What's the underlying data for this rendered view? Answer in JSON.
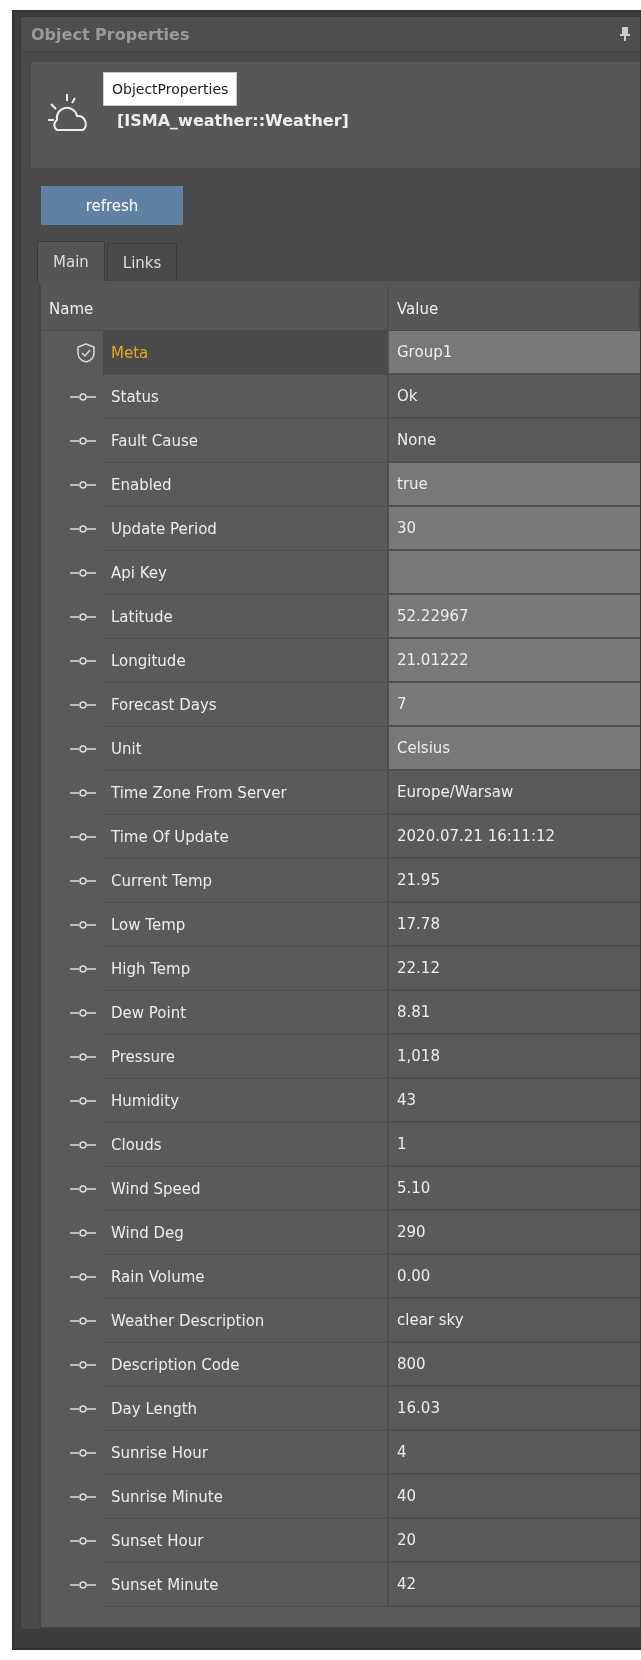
{
  "panel": {
    "title": "Object Properties"
  },
  "header": {
    "tooltip": "ObjectProperties",
    "object_type": "[ISMA_weather::Weather]"
  },
  "refresh_button": "refresh",
  "tabs": [
    {
      "label": "Main",
      "selected": true
    },
    {
      "label": "Links",
      "selected": false
    }
  ],
  "table": {
    "columns": [
      "Name",
      "Value"
    ],
    "rows": [
      {
        "kind": "meta",
        "name": "Meta",
        "value": "Group1",
        "editable": true
      },
      {
        "kind": "slot",
        "name": "Status",
        "value": "Ok",
        "editable": false
      },
      {
        "kind": "slot",
        "name": "Fault Cause",
        "value": "None",
        "editable": false
      },
      {
        "kind": "slot",
        "name": "Enabled",
        "value": "true",
        "editable": true
      },
      {
        "kind": "slot",
        "name": "Update Period",
        "value": "30",
        "editable": true
      },
      {
        "kind": "slot",
        "name": "Api Key",
        "editable": true
      },
      {
        "kind": "slot",
        "name": "Latitude",
        "value": "52.22967",
        "editable": true
      },
      {
        "kind": "slot",
        "name": "Longitude",
        "value": "21.01222",
        "editable": true
      },
      {
        "kind": "slot",
        "name": "Forecast Days",
        "value": "7",
        "editable": true
      },
      {
        "kind": "slot",
        "name": "Unit",
        "value": "Celsius",
        "editable": true
      },
      {
        "kind": "slot",
        "name": "Time Zone From Server",
        "value": "Europe/Warsaw",
        "editable": false
      },
      {
        "kind": "slot",
        "name": "Time Of Update",
        "value": "2020.07.21 16:11:12",
        "editable": false
      },
      {
        "kind": "slot",
        "name": "Current Temp",
        "value": "21.95",
        "editable": false
      },
      {
        "kind": "slot",
        "name": "Low Temp",
        "value": "17.78",
        "editable": false
      },
      {
        "kind": "slot",
        "name": "High Temp",
        "value": "22.12",
        "editable": false
      },
      {
        "kind": "slot",
        "name": "Dew Point",
        "value": "8.81",
        "editable": false
      },
      {
        "kind": "slot",
        "name": "Pressure",
        "value": "1,018",
        "editable": false
      },
      {
        "kind": "slot",
        "name": "Humidity",
        "value": "43",
        "editable": false
      },
      {
        "kind": "slot",
        "name": "Clouds",
        "value": "1",
        "editable": false
      },
      {
        "kind": "slot",
        "name": "Wind Speed",
        "value": "5.10",
        "editable": false
      },
      {
        "kind": "slot",
        "name": "Wind Deg",
        "value": "290",
        "editable": false
      },
      {
        "kind": "slot",
        "name": "Rain Volume",
        "value": "0.00",
        "editable": false
      },
      {
        "kind": "slot",
        "name": "Weather Description",
        "value": "clear sky",
        "editable": false
      },
      {
        "kind": "slot",
        "name": "Description Code",
        "value": "800",
        "editable": false
      },
      {
        "kind": "slot",
        "name": "Day Length",
        "value": "16.03",
        "editable": false
      },
      {
        "kind": "slot",
        "name": "Sunrise Hour",
        "value": "4",
        "editable": false
      },
      {
        "kind": "slot",
        "name": "Sunrise Minute",
        "value": "40",
        "editable": false
      },
      {
        "kind": "slot",
        "name": "Sunset Hour",
        "value": "20",
        "editable": false
      },
      {
        "kind": "slot",
        "name": "Sunset Minute",
        "value": "42",
        "editable": false
      }
    ]
  }
}
